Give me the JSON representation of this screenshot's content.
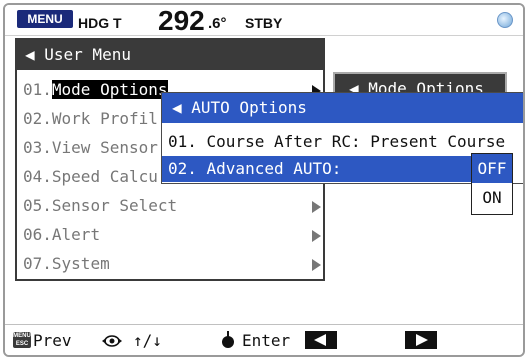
{
  "status": {
    "menu_label": "MENU",
    "heading_label": "HDG T",
    "heading_whole": "292",
    "heading_decimal": ".6°",
    "mode": "STBY",
    "gps_icon": "gps-status-icon"
  },
  "user_menu": {
    "title": "◀ User Menu",
    "items": [
      {
        "num": "01.",
        "label": "Mode Options"
      },
      {
        "num": "02.",
        "label": "Work Profil"
      },
      {
        "num": "03.",
        "label": "View Sensor"
      },
      {
        "num": "04.",
        "label": "Speed Calcu"
      },
      {
        "num": "05.",
        "label": "Sensor Select"
      },
      {
        "num": "06.",
        "label": "Alert"
      },
      {
        "num": "07.",
        "label": "System"
      }
    ]
  },
  "mode_tab": {
    "title": "◀ Mode Options"
  },
  "auto_options": {
    "title": "◀ AUTO Options",
    "rows": [
      {
        "text": "01. Course After RC:  Present Course"
      },
      {
        "text": "02. Advanced AUTO:"
      }
    ]
  },
  "dropdown": {
    "options": [
      "OFF",
      "ON"
    ],
    "selected": "OFF"
  },
  "bottom": {
    "esc": "MENU ESC",
    "prev": "Prev",
    "knob": "↑/↓",
    "enter": "Enter"
  }
}
